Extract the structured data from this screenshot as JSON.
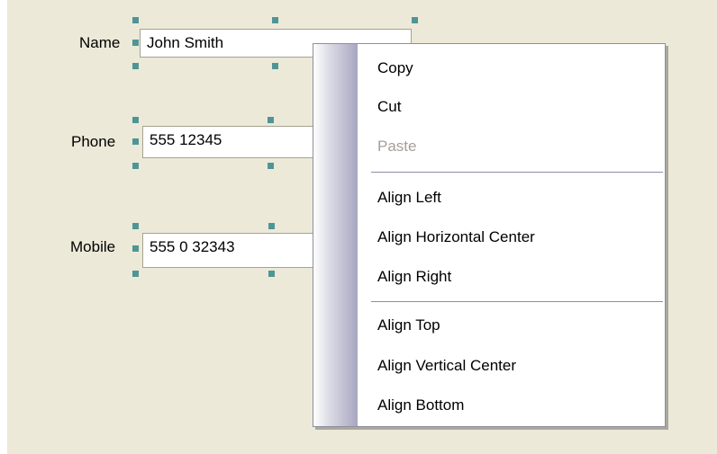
{
  "form": {
    "fields": [
      {
        "label": "Name",
        "value": "John Smith"
      },
      {
        "label": "Phone",
        "value": "555 12345"
      },
      {
        "label": "Mobile",
        "value": "555 0 32343"
      }
    ],
    "colors": {
      "surface": "#ece9d8",
      "selection_handle": "#4f9596",
      "textbox_border": "#a5a291"
    }
  },
  "context_menu": {
    "items": [
      {
        "label": "Copy",
        "enabled": true
      },
      {
        "label": "Cut",
        "enabled": true
      },
      {
        "label": "Paste",
        "enabled": false
      },
      {
        "label": "Align Left",
        "enabled": true
      },
      {
        "label": "Align Horizontal Center",
        "enabled": true
      },
      {
        "label": "Align Right",
        "enabled": true
      },
      {
        "label": "Align Top",
        "enabled": true
      },
      {
        "label": "Align Vertical Center",
        "enabled": true
      },
      {
        "label": "Align Bottom",
        "enabled": true
      }
    ],
    "colors": {
      "gutter_gradient_end": "#a8a6c0",
      "separator": "#8d8dab",
      "disabled_text": "#a4a098"
    }
  }
}
